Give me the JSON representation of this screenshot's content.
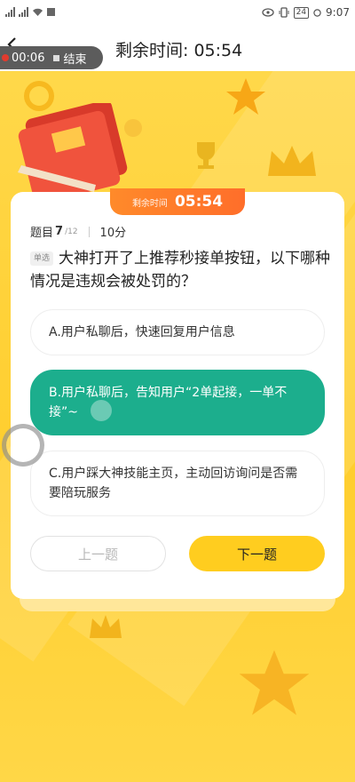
{
  "status_bar": {
    "battery": "24",
    "time": "9:07"
  },
  "top_bar": {
    "recording_time": "00:06",
    "stop_label": "结束",
    "remaining_title": "剩余时间: 05:54"
  },
  "timer_tab": {
    "label": "剩余时间",
    "value": "05:54"
  },
  "question": {
    "meta_prefix": "题目",
    "number": "7",
    "total": "/12",
    "score": "10分",
    "type": "单选",
    "text": "大神打开了上推荐秒接单按钮，以下哪种情况是违规会被处罚的？",
    "options": [
      {
        "label": "A.用户私聊后，快速回复用户信息",
        "selected": false
      },
      {
        "label": "B.用户私聊后，告知用户“2单起接，一单不接”~",
        "selected": true
      },
      {
        "label": "C.用户踩大神技能主页，主动回访询问是否需要陪玩服务",
        "selected": false
      }
    ]
  },
  "nav": {
    "prev_label": "上一题",
    "next_label": "下一题"
  },
  "colors": {
    "selected_option": "#1cae8d",
    "next_button": "#ffcd1f",
    "timer_tab": "#ff7a2a",
    "background": "#ffd43f"
  }
}
